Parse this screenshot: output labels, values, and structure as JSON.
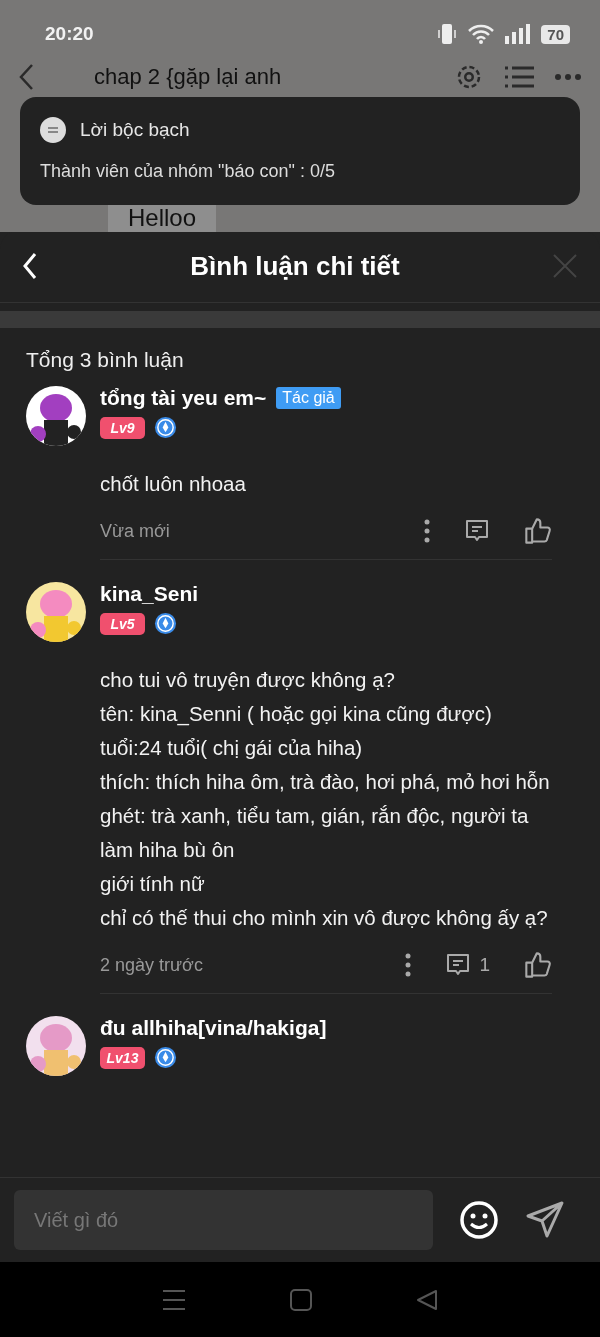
{
  "status_bar": {
    "time": "20:20",
    "battery": "70"
  },
  "background_page": {
    "title": "chap 2 {gặp lại anh",
    "message": "Helloo"
  },
  "toast": {
    "title": "Lời bộc bạch",
    "text": "Thành viên của nhóm \"báo con\" : 0/5"
  },
  "sheet": {
    "title": "Bình luận chi tiết",
    "total": "Tổng 3 bình luận",
    "comments": [
      {
        "name": "tổng tài yeu em~",
        "tag": "Tác giả",
        "level": "Lv9",
        "body": [
          "chốt luôn nhoaa"
        ],
        "time": "Vừa mới"
      },
      {
        "name": "kina_Seni",
        "level": "Lv5",
        "body": [
          "cho tui vô truyện được không ạ?",
          "tên: kina_Senni ( hoặc gọi kina cũng được)",
          "tuổi:24 tuổi( chị gái của hiha)",
          "thích: thích hiha ôm, trà đào, hơi phá, mỏ hơi hỗn",
          "ghét: trà xanh, tiểu tam, gián, rắn độc, người ta làm hiha bù ôn",
          "giới tính nữ",
          "chỉ có thế thui cho mình xin vô được không ấy ạ?"
        ],
        "time": "2 ngày trước",
        "replies": "1"
      },
      {
        "name": "đu allhiha[vina/hakiga]",
        "level": "Lv13"
      }
    ]
  },
  "composer": {
    "placeholder": "Viết gì đó"
  }
}
